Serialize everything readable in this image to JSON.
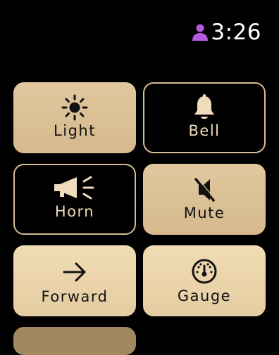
{
  "status": {
    "time": "3:26",
    "user_icon": "person-icon",
    "user_icon_color": "#b45be0"
  },
  "controls": [
    {
      "label": "Light",
      "icon": "sun-icon",
      "style": "filled"
    },
    {
      "label": "Bell",
      "icon": "bell-icon",
      "style": "outlined"
    },
    {
      "label": "Horn",
      "icon": "horn-icon",
      "style": "outlined"
    },
    {
      "label": "Mute",
      "icon": "mute-icon",
      "style": "filled"
    },
    {
      "label": "Forward",
      "icon": "arrow-right-icon",
      "style": "filled"
    },
    {
      "label": "Gauge",
      "icon": "gauge-icon",
      "style": "filled"
    }
  ],
  "colors": {
    "tile_fill": "#dcc095",
    "tile_outline": "#d7bc93",
    "outline_text": "#efdcbc",
    "background": "#000000"
  }
}
